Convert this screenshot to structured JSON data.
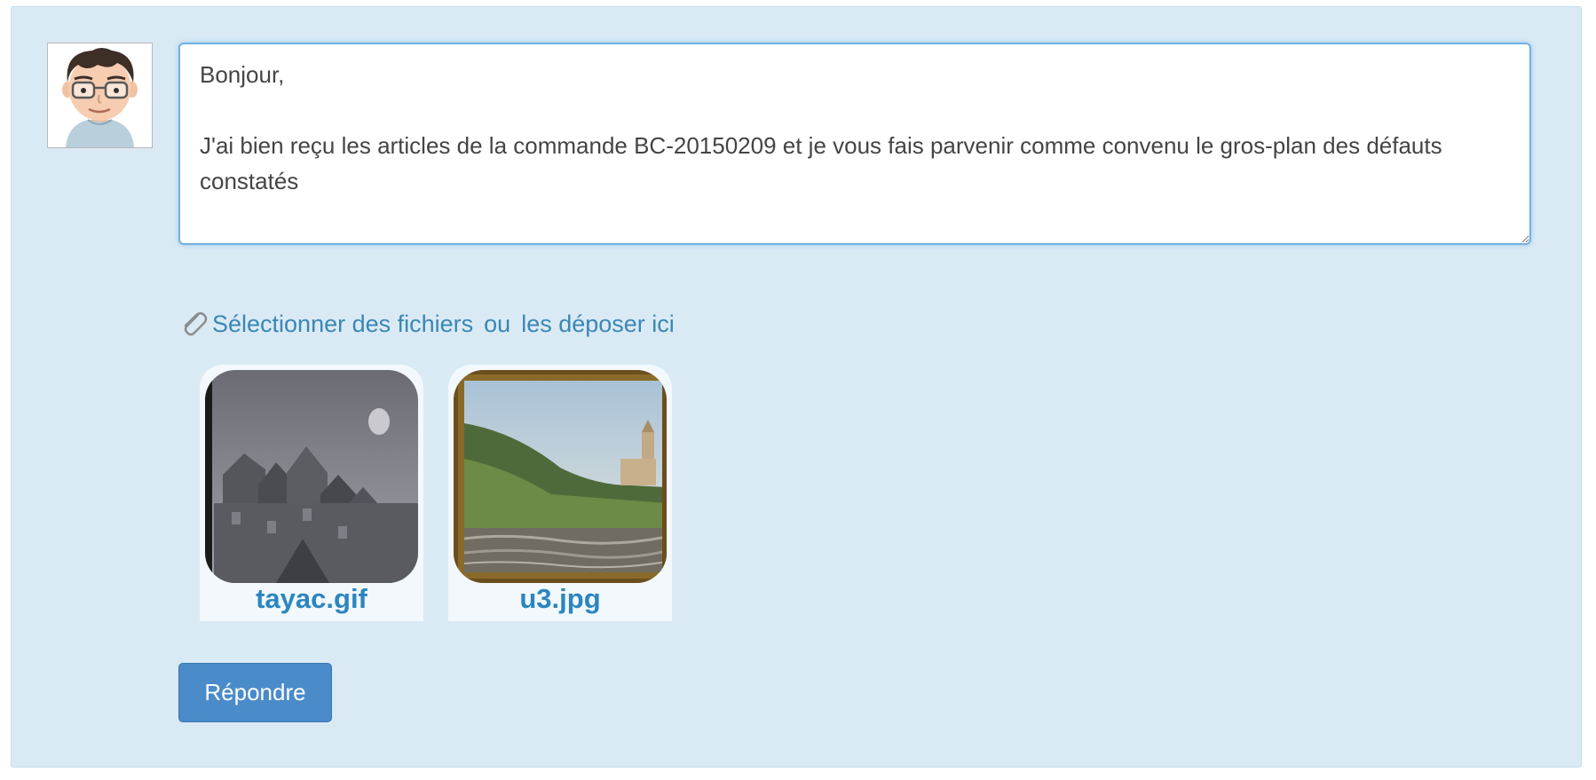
{
  "message": {
    "text": "Bonjour,\n\nJ'ai bien reçu les articles de la commande BC-20150209 et je vous fais parvenir comme convenu le gros-plan des défauts constatés"
  },
  "upload": {
    "select_label": "Sélectionner des fichiers",
    "or_label": "ou",
    "drop_label": "les déposer ici"
  },
  "attachments": [
    {
      "name": "tayac.gif"
    },
    {
      "name": "u3.jpg"
    }
  ],
  "actions": {
    "reply_label": "Répondre"
  },
  "colors": {
    "panel_bg": "#daeaf5",
    "link": "#3a87b4",
    "filename": "#2b86c0",
    "button": "#4a8bca"
  }
}
